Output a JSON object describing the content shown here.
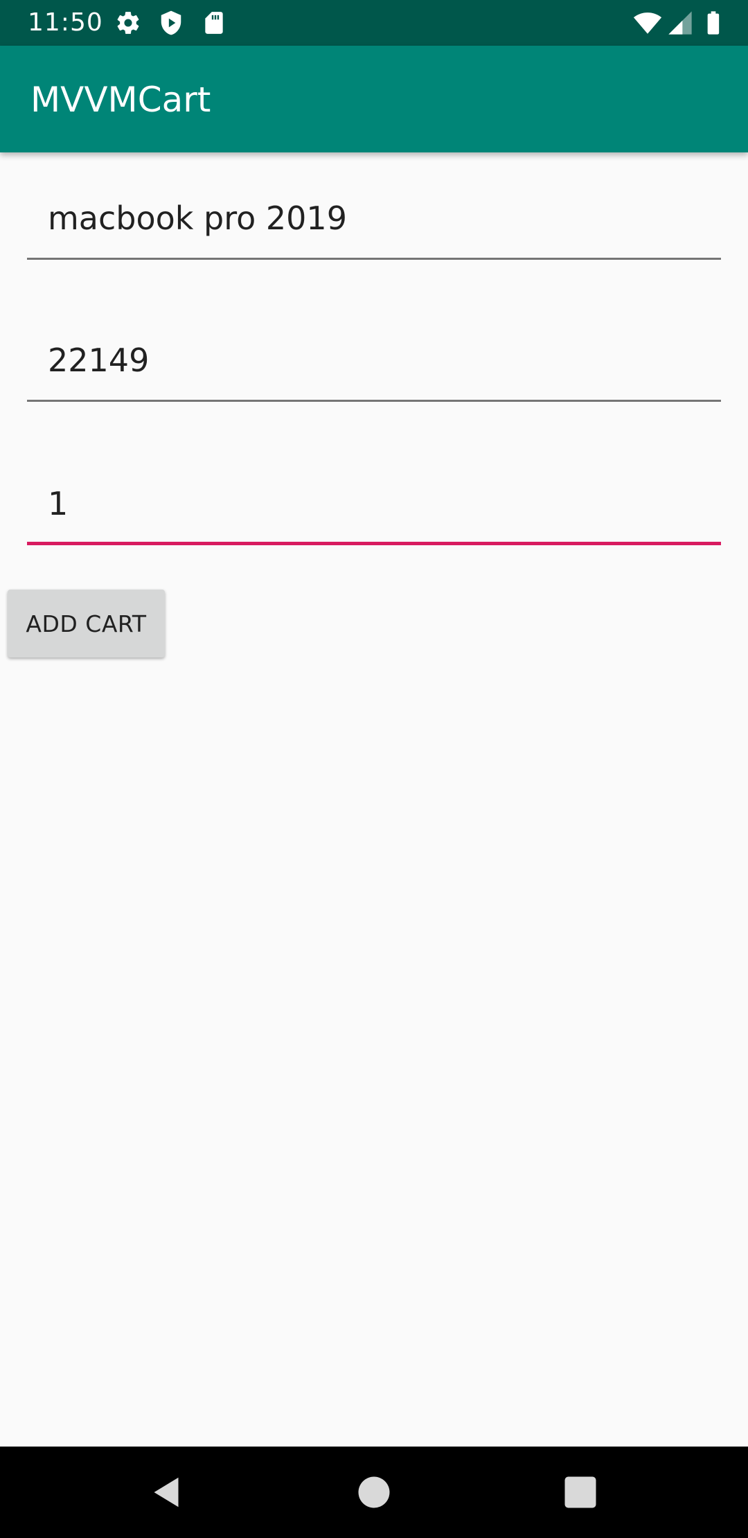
{
  "status_bar": {
    "time": "11:50",
    "icons": [
      "settings-icon",
      "play-protect-icon",
      "sd-card-icon",
      "wifi-icon",
      "cellular-signal-icon",
      "battery-icon"
    ]
  },
  "app_bar": {
    "title": "MVVMCart"
  },
  "form": {
    "product_name": "macbook pro 2019",
    "price": "22149",
    "quantity": "1"
  },
  "actions": {
    "add_cart_label": "ADD CART"
  },
  "colors": {
    "status_bar": "#00574b",
    "primary": "#008577",
    "accent": "#d81b60",
    "background": "#fafafa"
  },
  "nav_bar": {
    "buttons": [
      "back-icon",
      "home-icon",
      "recents-icon"
    ]
  }
}
